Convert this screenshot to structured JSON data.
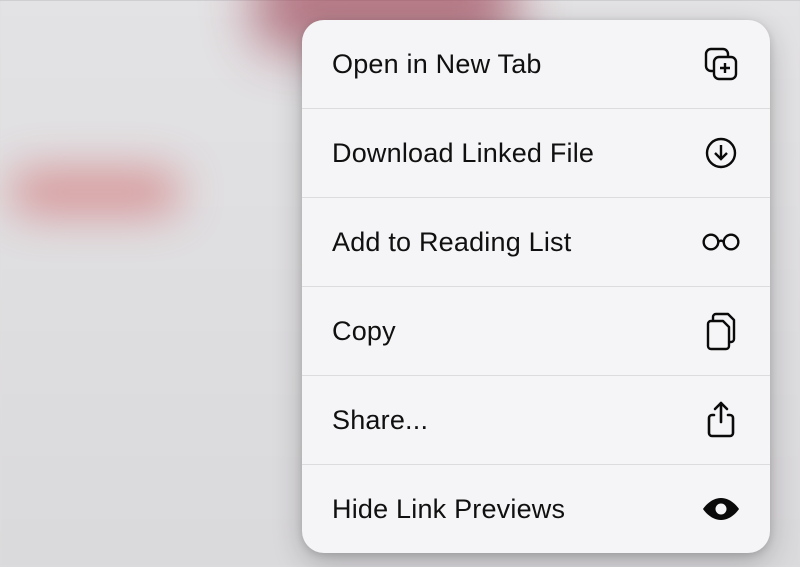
{
  "menu": {
    "items": [
      {
        "label": "Open in New Tab",
        "icon": "new-tab-icon"
      },
      {
        "label": "Download Linked File",
        "icon": "download-icon"
      },
      {
        "label": "Add to Reading List",
        "icon": "glasses-icon"
      },
      {
        "label": "Copy",
        "icon": "copy-docs-icon"
      },
      {
        "label": "Share...",
        "icon": "share-icon"
      },
      {
        "label": "Hide Link Previews",
        "icon": "eye-icon"
      }
    ]
  },
  "colors": {
    "menu_bg": "#f5f4f6",
    "divider": "#dcdbde",
    "text": "#101010"
  }
}
